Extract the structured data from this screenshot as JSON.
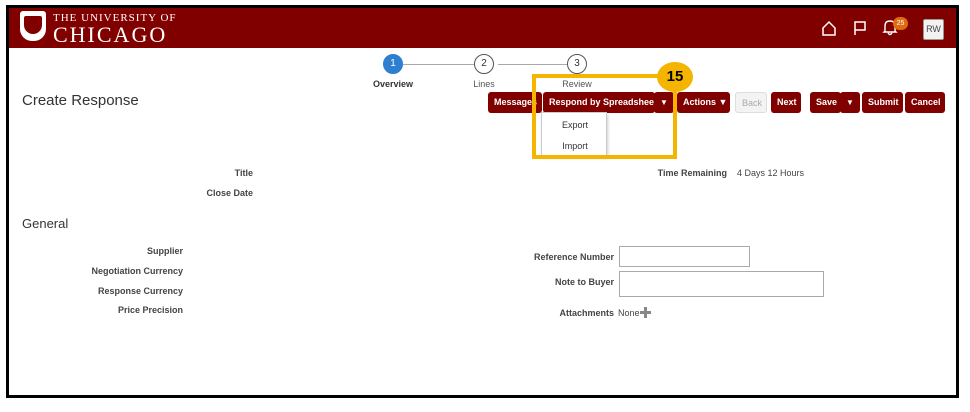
{
  "header": {
    "logo_line1": "THE UNIVERSITY OF",
    "logo_line2": "CHICAGO",
    "notification_count": "25",
    "user_initials": "RW",
    "brand_color": "#800000",
    "icons": [
      "home-icon",
      "flag-icon",
      "bell-icon"
    ]
  },
  "train": {
    "steps": [
      {
        "number": "1",
        "label": "Overview",
        "active": true
      },
      {
        "number": "2",
        "label": "Lines",
        "active": false
      },
      {
        "number": "3",
        "label": "Review",
        "active": false
      }
    ],
    "active_color": "#2f7fd1"
  },
  "page": {
    "title": "Create Response"
  },
  "toolbar": {
    "messages_label": "Messages",
    "respond_label": "Respond by Spreadsheet",
    "actions_label": "Actions",
    "back_label": "Back",
    "next_label": "Next",
    "save_label": "Save",
    "submit_label": "Submit",
    "cancel_label": "Cancel"
  },
  "dropdown": {
    "items": [
      "Export",
      "Import"
    ]
  },
  "callout": {
    "number": "15",
    "color": "#f5b400"
  },
  "summary": {
    "title_label": "Title",
    "close_date_label": "Close Date",
    "time_remaining_label": "Time Remaining",
    "time_remaining_value": "4 Days 12 Hours"
  },
  "general": {
    "heading": "General",
    "supplier_label": "Supplier",
    "negotiation_currency_label": "Negotiation Currency",
    "response_currency_label": "Response Currency",
    "price_precision_label": "Price Precision",
    "reference_number_label": "Reference Number",
    "reference_number_value": "",
    "note_to_buyer_label": "Note to Buyer",
    "note_to_buyer_value": "",
    "attachments_label": "Attachments",
    "attachments_value": "None"
  }
}
